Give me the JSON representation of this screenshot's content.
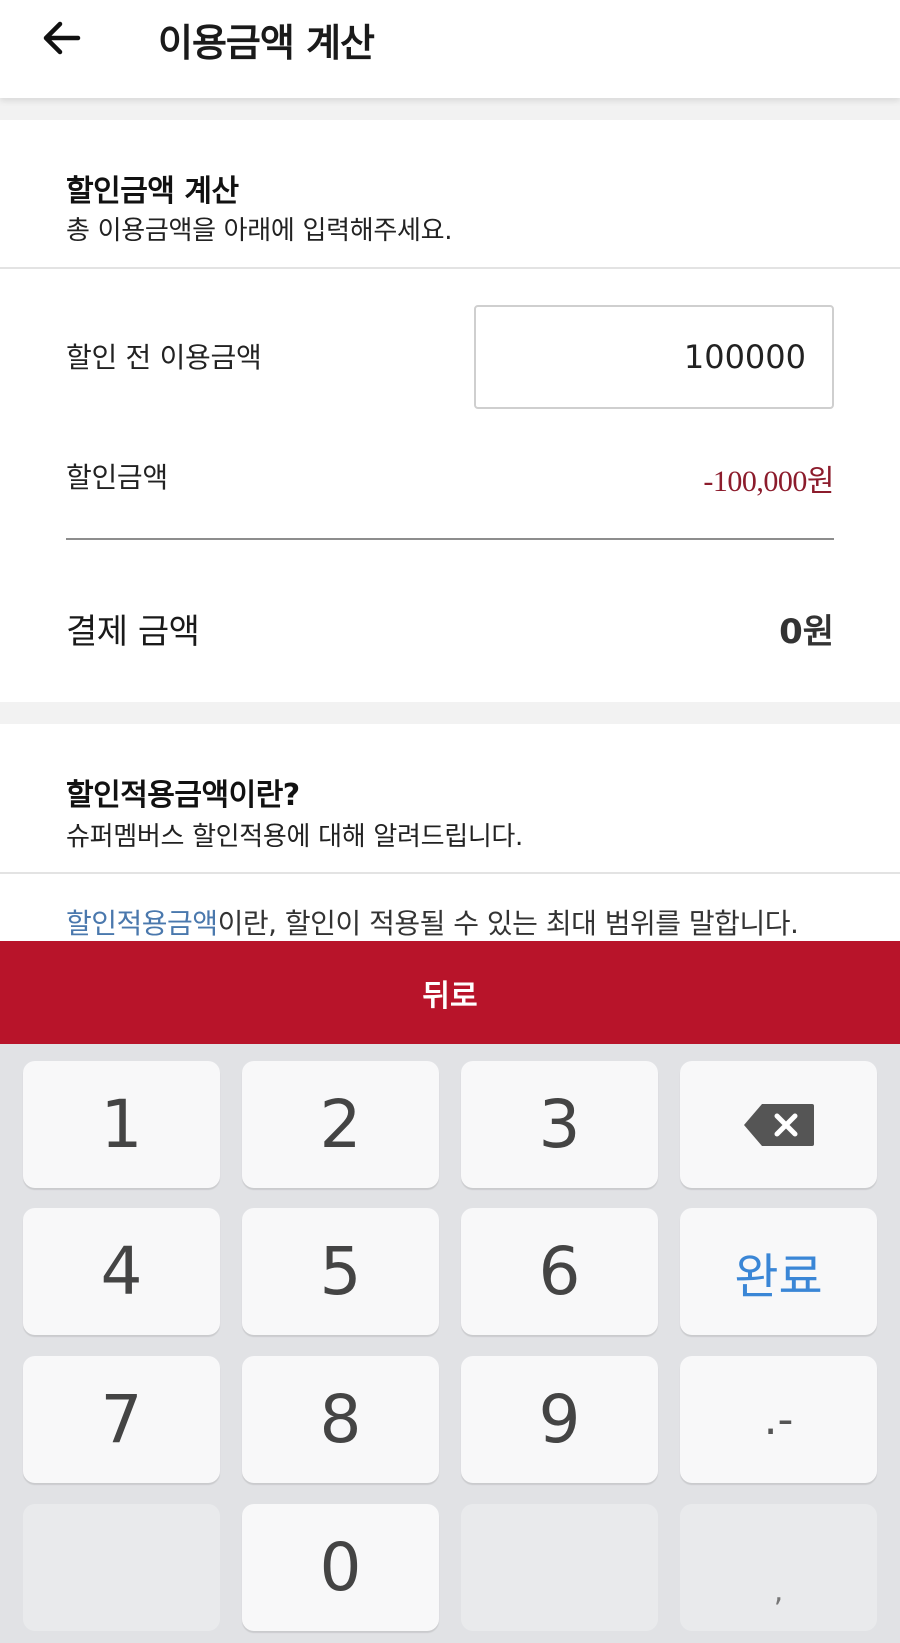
{
  "header": {
    "title": "이용금액 계산",
    "back_icon": "arrow-left-icon"
  },
  "calculator": {
    "title": "할인금액 계산",
    "subtitle": "총 이용금액을 아래에 입력해주세요.",
    "pre_discount_label": "할인 전 이용금액",
    "amount_input_value": "100000",
    "discount_label": "할인금액",
    "discount_value": "-100,000원",
    "payment_label": "결제 금액",
    "payment_value": "0원",
    "discount_color": "#8c1c2c"
  },
  "info": {
    "title": "할인적용금액이란?",
    "subtitle": "슈퍼멤버스 할인적용에 대해 알려드립니다.",
    "link_text": "할인적용금액",
    "body_text": "이란, 할인이 적용될 수 있는 최대 범위를 말합니다.",
    "link_color": "#4a78ad"
  },
  "back_bar": {
    "label": "뒤로",
    "color": "#b8142a"
  },
  "keyboard": {
    "keys": {
      "k1": "1",
      "k2": "2",
      "k3": "3",
      "k4": "4",
      "k5": "5",
      "k6": "6",
      "k7": "7",
      "k8": "8",
      "k9": "9",
      "k0": "0",
      "done": "완료",
      "punct": ".-",
      "comma": ","
    },
    "backspace_icon": "backspace-icon",
    "done_color": "#3a86d6"
  }
}
